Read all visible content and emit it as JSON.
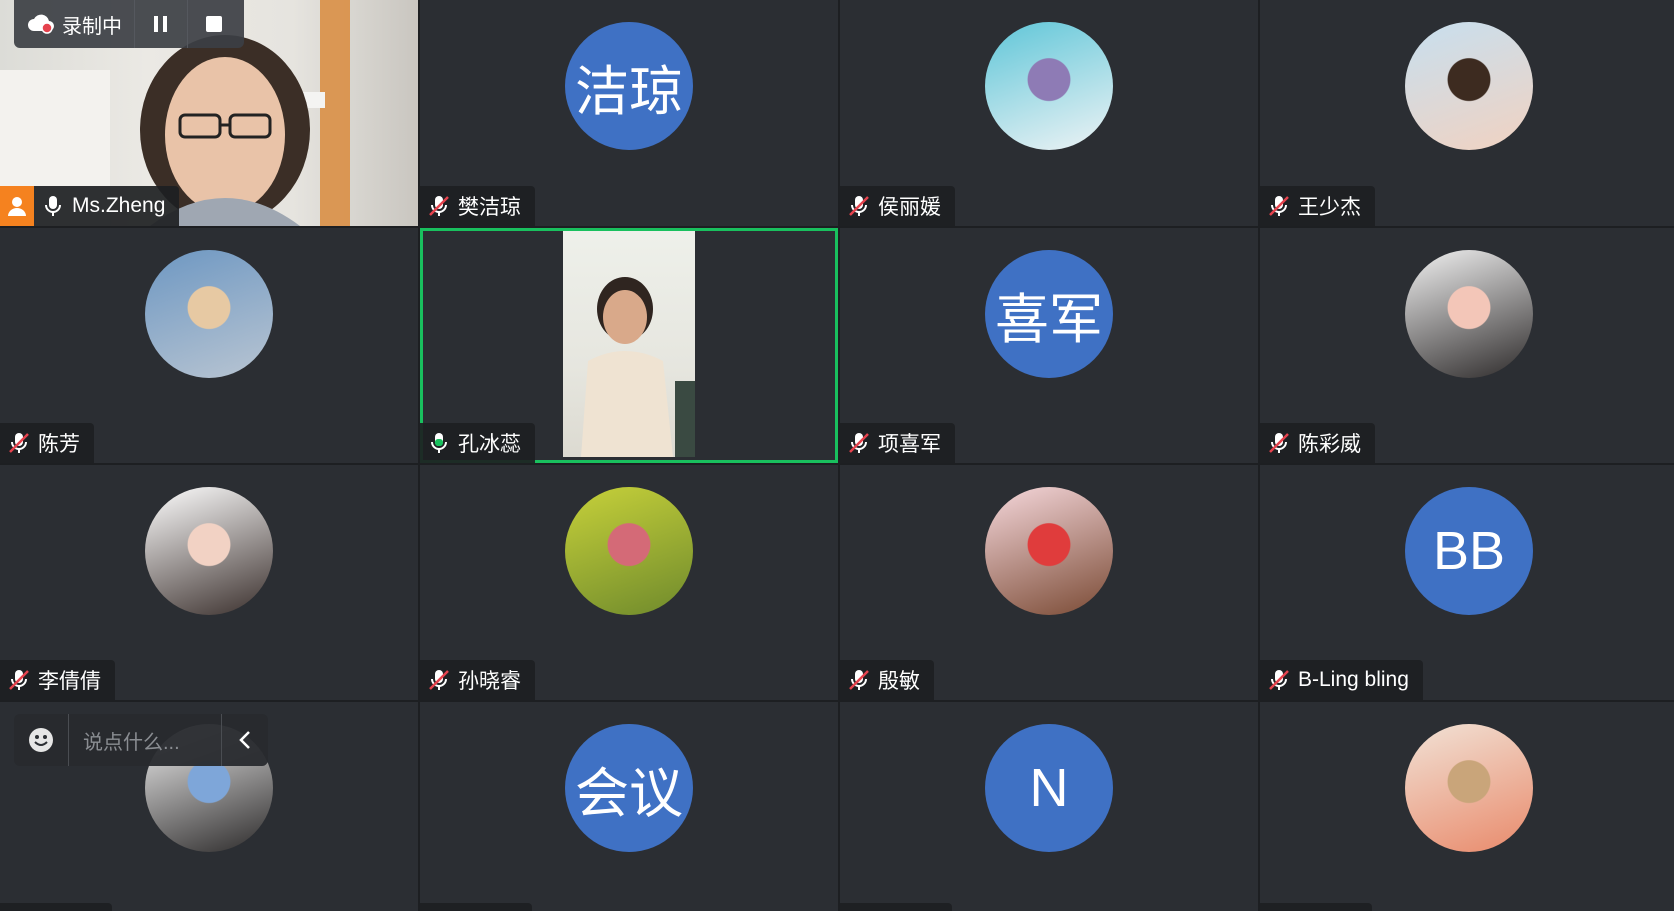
{
  "recording": {
    "status_label": "录制中"
  },
  "chat": {
    "placeholder": "说点什么..."
  },
  "participants": [
    {
      "name": "Ms.Zheng",
      "avatar_text": "",
      "mic": "on",
      "type": "self-video",
      "is_owner": true
    },
    {
      "name": "樊洁琼",
      "avatar_text": "洁琼",
      "mic": "muted",
      "type": "initials"
    },
    {
      "name": "侯丽媛",
      "avatar_text": "",
      "mic": "muted",
      "type": "photo",
      "photo_colors": [
        "#5fc6d8",
        "#eef3f5",
        "#8e7bb5"
      ]
    },
    {
      "name": "王少杰",
      "avatar_text": "",
      "mic": "muted",
      "type": "photo",
      "photo_colors": [
        "#c7dfef",
        "#f1d2c1",
        "#3d2b20"
      ]
    },
    {
      "name": "陈芳",
      "avatar_text": "",
      "mic": "muted",
      "type": "photo",
      "photo_colors": [
        "#6d97c2",
        "#b9c5d2",
        "#e7c9a3"
      ]
    },
    {
      "name": "孔冰蕊",
      "avatar_text": "",
      "mic": "speaking",
      "type": "video",
      "active": true
    },
    {
      "name": "项喜军",
      "avatar_text": "喜军",
      "mic": "muted",
      "type": "initials"
    },
    {
      "name": "陈彩威",
      "avatar_text": "",
      "mic": "muted",
      "type": "photo",
      "photo_colors": [
        "#f2f2f2",
        "#2d2a2a",
        "#f3c6b8"
      ]
    },
    {
      "name": "李倩倩",
      "avatar_text": "",
      "mic": "muted",
      "type": "photo",
      "photo_colors": [
        "#ffffff",
        "#3a2f2c",
        "#f2d2c4"
      ]
    },
    {
      "name": "孙晓睿",
      "avatar_text": "",
      "mic": "muted",
      "type": "photo",
      "photo_colors": [
        "#c7d13a",
        "#6f8a2c",
        "#d46a77"
      ]
    },
    {
      "name": "殷敏",
      "avatar_text": "",
      "mic": "muted",
      "type": "photo",
      "photo_colors": [
        "#f6d8dc",
        "#7a4a34",
        "#e03c3c"
      ]
    },
    {
      "name": "B-Ling bling",
      "avatar_text": "BB",
      "mic": "muted",
      "type": "initials"
    },
    {
      "name": "",
      "avatar_text": "",
      "mic": "muted",
      "type": "photo",
      "photo_colors": [
        "#f3f3f3",
        "#2c2a2a",
        "#7ea6d9"
      ]
    },
    {
      "name": "",
      "avatar_text": "会议",
      "mic": "muted",
      "type": "initials"
    },
    {
      "name": "",
      "avatar_text": "N",
      "mic": "muted",
      "type": "initials"
    },
    {
      "name": "",
      "avatar_text": "",
      "mic": "muted",
      "type": "photo",
      "photo_colors": [
        "#f1e2d6",
        "#e98a6b",
        "#c9a57a"
      ]
    }
  ],
  "colors": {
    "tile_bg": "#2b2e33",
    "avatar_blue": "#3f71c4",
    "active_border": "#19c05e",
    "muted_red": "#e5424d",
    "owner_orange": "#f5821f"
  }
}
